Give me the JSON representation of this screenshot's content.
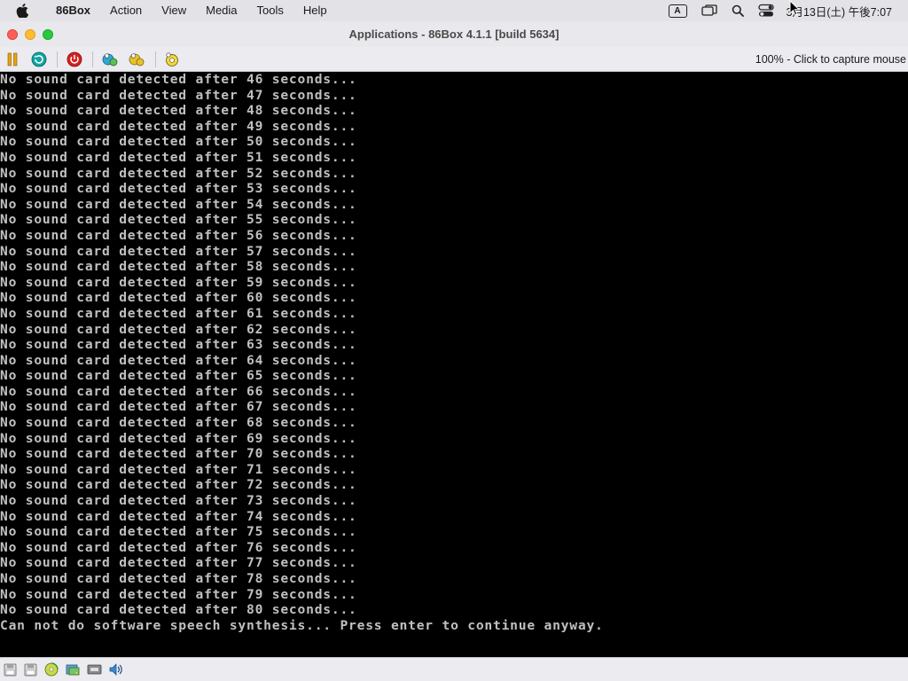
{
  "menubar": {
    "app_name": "86Box",
    "menus": [
      "Action",
      "View",
      "Media",
      "Tools",
      "Help"
    ],
    "input_indicator": "A",
    "clock": "3月13日(土) 午後7:07"
  },
  "window": {
    "title": "Applications - 86Box 4.1.1 [build 5634]"
  },
  "toolbar": {
    "capture_status": "100% - Click to capture mouse"
  },
  "console": {
    "lines": [
      "No sound card detected after 46 seconds...",
      "No sound card detected after 47 seconds...",
      "No sound card detected after 48 seconds...",
      "No sound card detected after 49 seconds...",
      "No sound card detected after 50 seconds...",
      "No sound card detected after 51 seconds...",
      "No sound card detected after 52 seconds...",
      "No sound card detected after 53 seconds...",
      "No sound card detected after 54 seconds...",
      "No sound card detected after 55 seconds...",
      "No sound card detected after 56 seconds...",
      "No sound card detected after 57 seconds...",
      "No sound card detected after 58 seconds...",
      "No sound card detected after 59 seconds...",
      "No sound card detected after 60 seconds...",
      "No sound card detected after 61 seconds...",
      "No sound card detected after 62 seconds...",
      "No sound card detected after 63 seconds...",
      "No sound card detected after 64 seconds...",
      "No sound card detected after 65 seconds...",
      "No sound card detected after 66 seconds...",
      "No sound card detected after 67 seconds...",
      "No sound card detected after 68 seconds...",
      "No sound card detected after 69 seconds...",
      "No sound card detected after 70 seconds...",
      "No sound card detected after 71 seconds...",
      "No sound card detected after 72 seconds...",
      "No sound card detected after 73 seconds...",
      "No sound card detected after 74 seconds...",
      "No sound card detected after 75 seconds...",
      "No sound card detected after 76 seconds...",
      "No sound card detected after 77 seconds...",
      "No sound card detected after 78 seconds...",
      "No sound card detected after 79 seconds...",
      "No sound card detected after 80 seconds...",
      "Can not do software speech synthesis... Press enter to continue anyway."
    ]
  },
  "icons": {
    "toolbar": [
      "pause-icon",
      "reset-icon",
      "power-icon",
      "ctrl-alt-del-icon",
      "ctrl-alt-esc-icon",
      "settings-icon"
    ],
    "statusbar": [
      "floppy-a-icon",
      "floppy-b-icon",
      "cdrom-icon",
      "hard-disk-icon",
      "network-icon",
      "sound-icon"
    ]
  },
  "colors": {
    "screen_bg": "#000000",
    "console_text": "#c0c0c0",
    "close": "#fe5f57",
    "minimize": "#febc2e",
    "maximize": "#28c840"
  }
}
